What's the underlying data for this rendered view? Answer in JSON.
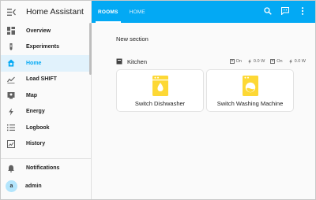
{
  "app": {
    "title": "Home Assistant"
  },
  "sidebar": {
    "items": [
      {
        "label": "Overview",
        "icon": "overview-icon"
      },
      {
        "label": "Experiments",
        "icon": "flask-icon"
      },
      {
        "label": "Home",
        "icon": "home-icon",
        "active": true
      },
      {
        "label": "Load SHIFT",
        "icon": "chart-line-icon"
      },
      {
        "label": "Map",
        "icon": "map-icon"
      },
      {
        "label": "Energy",
        "icon": "lightning-icon"
      },
      {
        "label": "Logbook",
        "icon": "list-icon"
      },
      {
        "label": "History",
        "icon": "history-chart-icon"
      }
    ],
    "bottom": {
      "notifications": "Notifications",
      "user": "admin",
      "avatar_letter": "a"
    }
  },
  "topbar": {
    "tabs": [
      {
        "label": "ROOMS",
        "active": true
      },
      {
        "label": "HOME",
        "active": false
      }
    ],
    "actions": [
      "search-icon",
      "assist-icon",
      "more-vert-icon"
    ]
  },
  "main": {
    "section_title": "New section",
    "area": {
      "name": "Kitchen",
      "stats": [
        {
          "icon": "switch-icon",
          "text": "On"
        },
        {
          "icon": "power-icon",
          "text": "0.0 W"
        },
        {
          "icon": "switch-icon",
          "text": "On"
        },
        {
          "icon": "power-icon",
          "text": "0.0 W"
        }
      ]
    },
    "cards": [
      {
        "label": "Switch Dishwasher",
        "icon": "dishwasher-icon"
      },
      {
        "label": "Switch Washing Machine",
        "icon": "washing-machine-icon"
      }
    ]
  },
  "colors": {
    "accent": "#03a9f4",
    "active_bg": "#e1f2fc",
    "tile_icon": "#fdd835"
  }
}
